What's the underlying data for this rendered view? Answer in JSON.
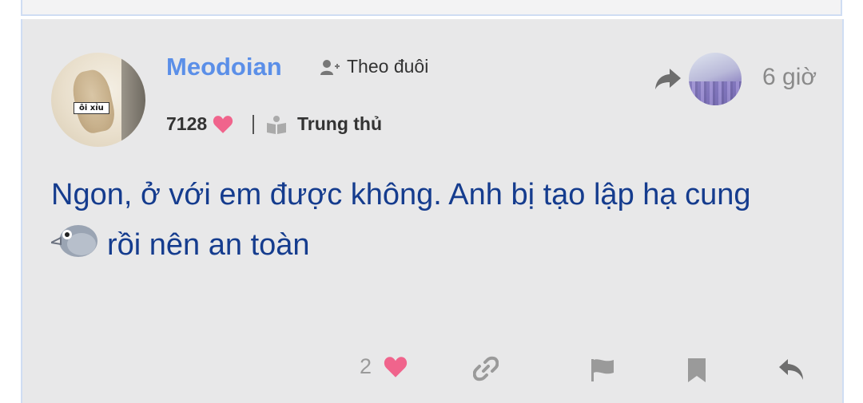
{
  "post": {
    "author": {
      "name": "Meodoian",
      "avatar_text": "ôi xỉu",
      "points": "7128",
      "rank": "Trung thủ"
    },
    "follow_label": "Theo đuôi",
    "time": "6 giờ",
    "content_line1": "Ngon, ở với em được không. Anh bị tạo lập hạ cung",
    "content_line2": "rồi nên an toàn",
    "like_count": "2"
  },
  "colors": {
    "username": "#5b8fe8",
    "content": "#153c8e",
    "heart": "#f0648c",
    "icon_gray": "#9a9a9a",
    "background": "#e8e8e9"
  },
  "icons": [
    "follow-user-icon",
    "heart-icon",
    "rank-book-icon",
    "share-icon",
    "bird-emoji",
    "link-icon",
    "flag-icon",
    "bookmark-icon",
    "reply-icon"
  ]
}
